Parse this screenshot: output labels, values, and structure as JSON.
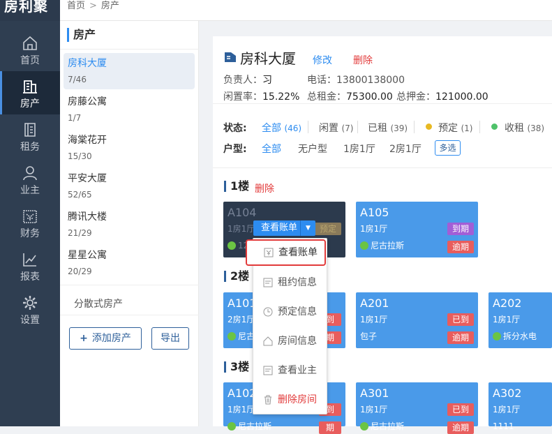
{
  "app": {
    "logo": "房利聚"
  },
  "breadcrumb": {
    "home": "首页",
    "sep": ">",
    "current": "房产"
  },
  "nav": [
    {
      "label": "首页",
      "icon": "home-icon"
    },
    {
      "label": "房产",
      "icon": "building-icon",
      "active": true
    },
    {
      "label": "租务",
      "icon": "ledger-icon"
    },
    {
      "label": "业主",
      "icon": "user-icon"
    },
    {
      "label": "财务",
      "icon": "finance-icon"
    },
    {
      "label": "报表",
      "icon": "chart-icon"
    },
    {
      "label": "设置",
      "icon": "gear-icon"
    }
  ],
  "left_panel": {
    "title": "房产",
    "buildings": [
      {
        "name": "房科大厦",
        "count": "7/46"
      },
      {
        "name": "房藤公寓",
        "count": "1/7"
      },
      {
        "name": "海棠花开",
        "count": "15/30"
      },
      {
        "name": "平安大厦",
        "count": "52/65"
      },
      {
        "name": "腾讯大楼",
        "count": "21/29"
      },
      {
        "name": "星星公寓",
        "count": "20/29"
      }
    ],
    "scatter": "分散式房产",
    "add_button": "添加房产",
    "add_icon": "+",
    "export_button": "导出"
  },
  "building": {
    "name": "房科大厦",
    "edit": "修改",
    "delete": "删除",
    "manager_label": "负责人：",
    "manager": "习",
    "phone_label": "电话：",
    "phone": "13800138000",
    "vacancy_label": "闲置率：",
    "vacancy": "15.22%",
    "rent_label": "总租金：",
    "rent": "75300.00",
    "deposit_label": "总押金：",
    "deposit": "121000.00"
  },
  "filters": {
    "status_label": "状态:",
    "status": [
      {
        "label": "全部",
        "count": "(46)"
      },
      {
        "label": "闲置",
        "count": "(7)"
      },
      {
        "label": "已租",
        "count": "(39)"
      },
      {
        "label": "预定",
        "count": "(1)"
      },
      {
        "label": "收租",
        "count": "(38)"
      }
    ],
    "type_label": "户型:",
    "types": [
      "全部",
      "无户型",
      "1房1厅",
      "2房1厅"
    ],
    "multi": "多选",
    "colors": {
      "reserve_dot": "#e8b923",
      "collect_dot": "#4fc26a"
    }
  },
  "floors": [
    {
      "label": "1楼",
      "delete": "删除"
    },
    {
      "label": "2楼"
    },
    {
      "label": "3楼"
    }
  ],
  "rooms": {
    "a104": {
      "no": "A104",
      "type": "1房1厅",
      "badge": "预定",
      "tenant": "12"
    },
    "a105": {
      "no": "A105",
      "type": "1房1厅",
      "badge1": "到期",
      "badge2": "逾期",
      "tenant": "尼古拉斯"
    },
    "a101": {
      "no": "A101",
      "type": "2房1厅",
      "badge1": "到",
      "badge2": "期",
      "tenant": "尼古"
    },
    "a201": {
      "no": "A201",
      "type": "1房1厅",
      "badge1": "已到",
      "badge2": "逾期",
      "tenant": "包子"
    },
    "a202": {
      "no": "A202",
      "type": "1房1厅",
      "tenant": "拆分水电"
    },
    "a102": {
      "no": "A102",
      "type": "1房1厅",
      "badge1": "到",
      "badge2": "期",
      "tenant": "尼古拉斯"
    },
    "a301": {
      "no": "A301",
      "type": "1房1厅",
      "badge1": "已到",
      "badge2": "逾期",
      "tenant": "尼古拉斯"
    },
    "a302": {
      "no": "A302",
      "type": "1房1厅",
      "tenant": "1111"
    }
  },
  "action": {
    "primary": "查看账单",
    "caret": "▼"
  },
  "menu": [
    "查看账单",
    "租约信息",
    "预定信息",
    "房间信息",
    "查看业主",
    "删除房间"
  ]
}
